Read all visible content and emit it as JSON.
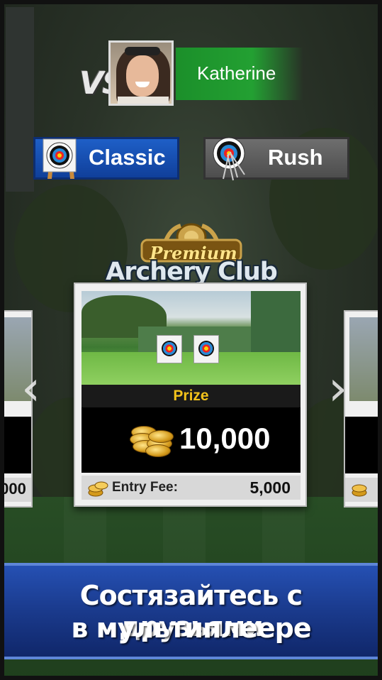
{
  "opponent": {
    "vs_label": "VS",
    "name": "Katherine"
  },
  "modes": {
    "classic_label": "Classic",
    "rush_label": "Rush"
  },
  "club": {
    "premium_label": "Premium",
    "title": "Archery Club"
  },
  "card": {
    "prize_label": "Prize",
    "prize_amount": "10,000",
    "entry_fee_label": "Entry Fee:",
    "entry_fee_amount": "5,000"
  },
  "side_cards": {
    "left_fee_partial": ",000"
  },
  "banner": {
    "line1": "Состязайтесь с друзьями",
    "line2": "в мультиплеере"
  },
  "colors": {
    "classic_blue": "#1e5fc7",
    "opponent_green": "#23a032",
    "prize_gold": "#f2c21b",
    "banner_blue": "#1a3a8c"
  },
  "icons": {
    "classic": "target-stand-icon",
    "rush": "target-arrows-icon",
    "prev": "chevron-left-icon",
    "next": "chevron-right-icon",
    "coins": "gold-coins-icon"
  }
}
